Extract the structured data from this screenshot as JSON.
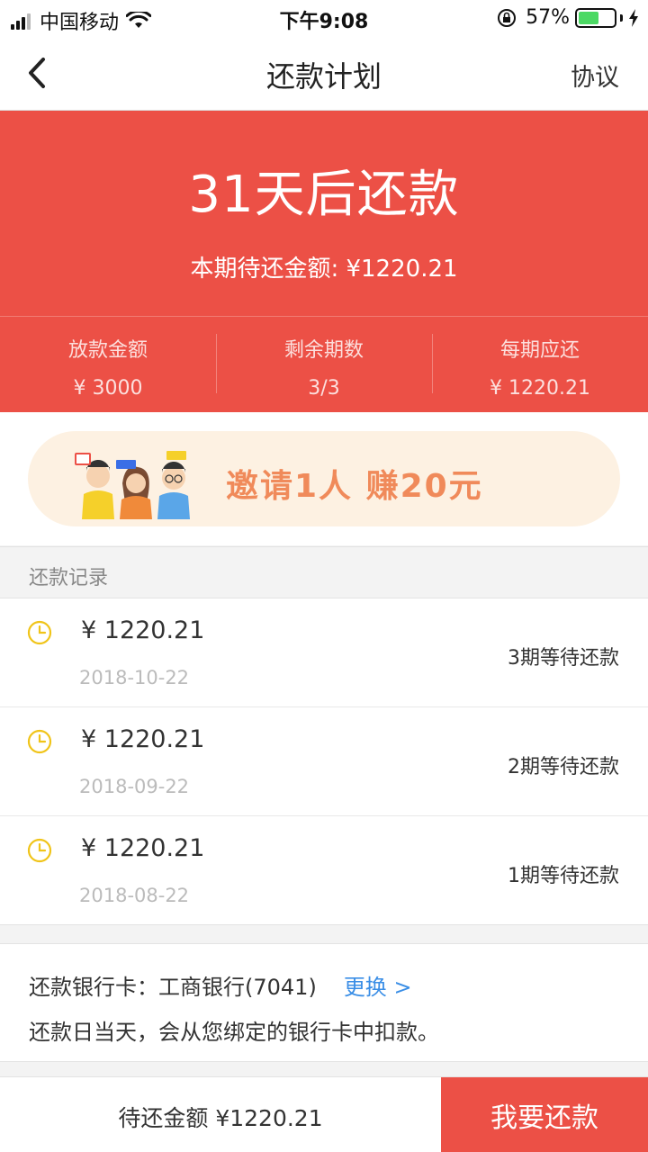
{
  "status_bar": {
    "carrier": "中国移动",
    "time": "下午9:08",
    "battery_pct": "57%",
    "battery_level": 0.57,
    "icons": [
      "signal-icon",
      "wifi-icon",
      "orientation-lock-icon",
      "battery-icon",
      "charging-bolt-icon"
    ]
  },
  "nav": {
    "title": "还款计划",
    "right_label": "协议",
    "back_icon": "chevron-left-icon"
  },
  "hero": {
    "title": "31天后还款",
    "subtitle": "本期待还金额: ¥1220.21",
    "stats": [
      {
        "label": "放款金额",
        "value": "¥ 3000"
      },
      {
        "label": "剩余期数",
        "value": "3/3"
      },
      {
        "label": "每期应还",
        "value": "¥ 1220.21"
      }
    ]
  },
  "banner": {
    "text": "邀请1人 赚20元"
  },
  "records": {
    "header": "还款记录",
    "items": [
      {
        "amount": "¥  1220.21",
        "date": "2018-10-22",
        "status": "3期等待还款"
      },
      {
        "amount": "¥  1220.21",
        "date": "2018-09-22",
        "status": "2期等待还款"
      },
      {
        "amount": "¥  1220.21",
        "date": "2018-08-22",
        "status": "1期等待还款"
      }
    ]
  },
  "bank": {
    "label": "还款银行卡：工商银行(7041)",
    "change_label": "更换 >",
    "note": "还款日当天，会从您绑定的银行卡中扣款。"
  },
  "bottom": {
    "amount_label": "待还金额 ¥1220.21",
    "pay_label": "我要还款"
  },
  "colors": {
    "accent": "#ec5046",
    "link": "#3a8ee6",
    "clock": "#f0c419",
    "battery": "#4cd964"
  }
}
